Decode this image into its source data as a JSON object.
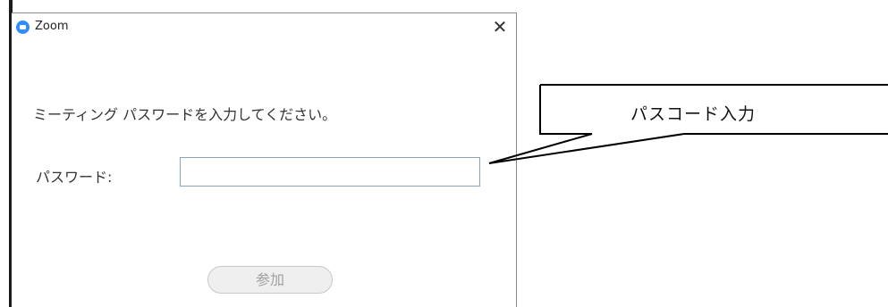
{
  "window": {
    "title": "Zoom",
    "close_glyph": "✕",
    "logo_icon": "zoom-logo-icon"
  },
  "dialog": {
    "prompt": "ミーティング パスワードを入力してください。",
    "password_label": "パスワード:",
    "password_value": "",
    "join_label": "参加"
  },
  "callout": {
    "text": "パスコード入力"
  }
}
